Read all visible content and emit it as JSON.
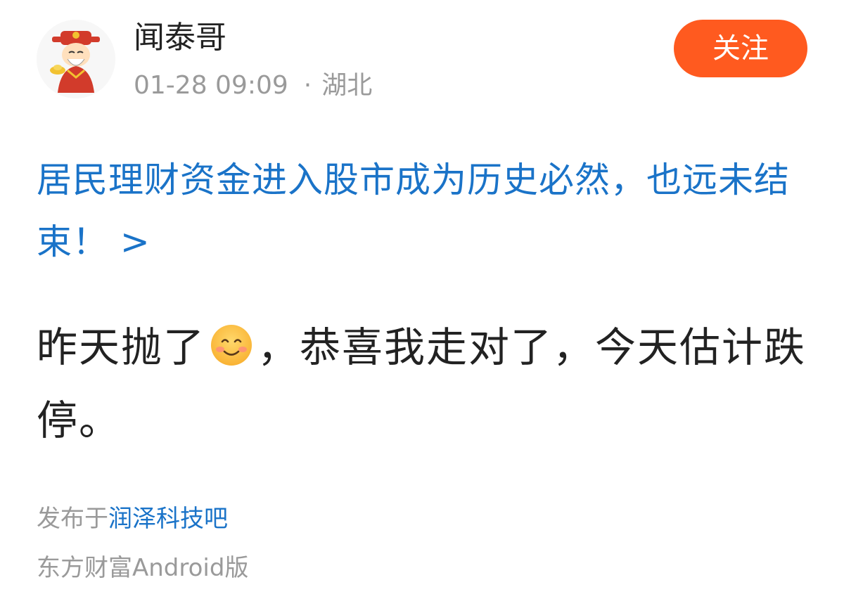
{
  "post": {
    "author": {
      "name": "闻泰哥",
      "avatar_icon": "caishen-avatar-icon"
    },
    "time": "01-28 09:09",
    "separator": "·",
    "location": "湖北",
    "follow_label": "关注",
    "topic_link": "居民理财资金进入股市成为历史必然，也远未结束！ >",
    "body_before_emoji": "昨天抛了",
    "emoji_icon": "smile-emoji-icon",
    "body_after_emoji": "，恭喜我走对了，今天估计跌停。",
    "posted_in_prefix": "发布于",
    "board_name": "润泽科技吧",
    "client": "东方财富Android版"
  },
  "colors": {
    "accent": "#ff5a1f",
    "link": "#1a73c8",
    "text": "#222222",
    "muted": "#9a9a9a"
  }
}
